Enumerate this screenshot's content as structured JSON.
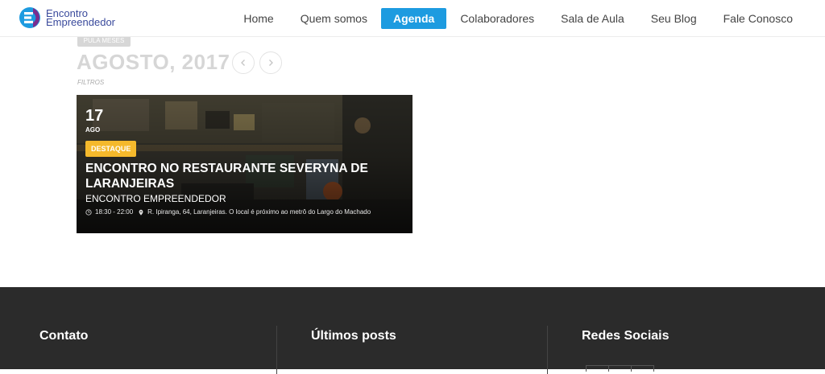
{
  "logo": {
    "line1": "Encontro",
    "line2": "Empreendedor"
  },
  "nav": {
    "items": [
      {
        "label": "Home",
        "active": false
      },
      {
        "label": "Quem somos",
        "active": false
      },
      {
        "label": "Agenda",
        "active": true
      },
      {
        "label": "Colaboradores",
        "active": false
      },
      {
        "label": "Sala de Aula",
        "active": false
      },
      {
        "label": "Seu Blog",
        "active": false
      },
      {
        "label": "Fale Conosco",
        "active": false
      }
    ]
  },
  "month": {
    "pill": "PULA MESES",
    "title": "AGOSTO, 2017",
    "filters": "FILTROS",
    "prev_icon": "chevron-left-icon",
    "next_icon": "chevron-right-icon"
  },
  "event": {
    "day": "17",
    "month": "AGO",
    "badge": "DESTAQUE",
    "title": "ENCONTRO NO RESTAURANTE SEVERYNA DE LARANJEIRAS",
    "organizer": "ENCONTRO EMPREENDEDOR",
    "time": "18:30 - 22:00",
    "location": "R. Ipiranga, 64, Laranjeiras. O local é próximo ao metrô do Largo do Machado"
  },
  "footer": {
    "col1": "Contato",
    "col2": "Últimos posts",
    "col3": "Redes Sociais"
  },
  "colors": {
    "accent": "#1d9be0",
    "badge": "#f5b92c",
    "footer_bg": "#2b2b2b"
  }
}
